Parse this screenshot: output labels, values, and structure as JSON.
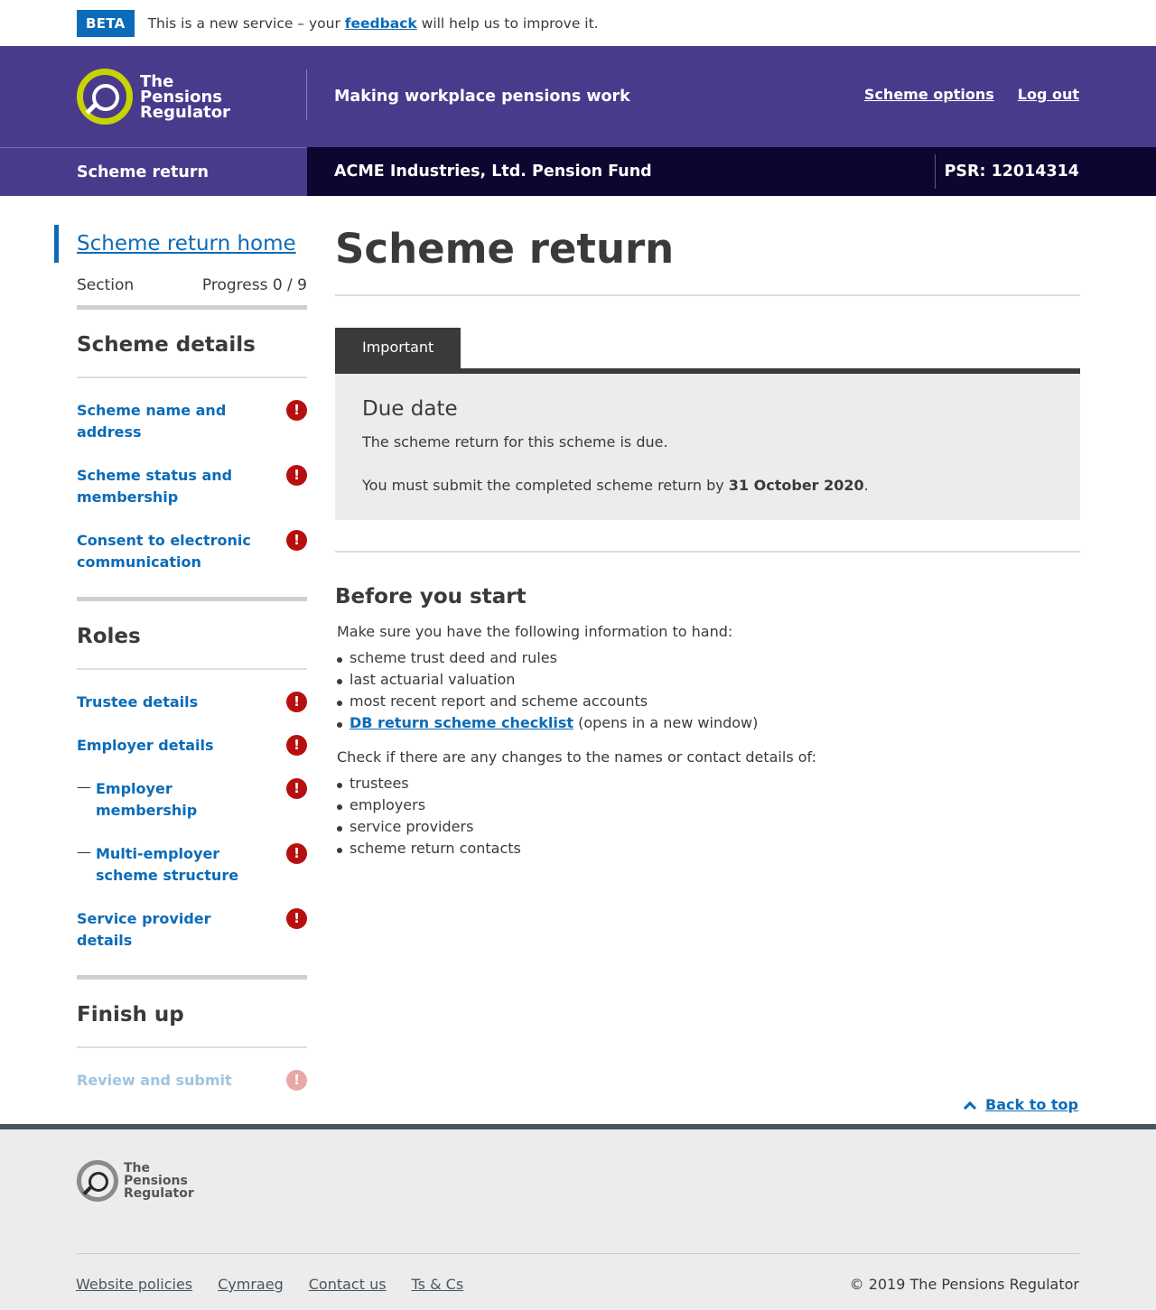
{
  "beta": {
    "tag": "BETA",
    "text_before": "This is a new service – your",
    "link": "feedback",
    "text_after": "will help us to improve it."
  },
  "header": {
    "logo_lines": [
      "The",
      "Pensions",
      "Regulator"
    ],
    "tagline": "Making workplace pensions work",
    "links": [
      "Scheme options",
      "Log out"
    ]
  },
  "subheader": {
    "section": "Scheme return",
    "scheme_name": "ACME Industries, Ltd. Pension Fund",
    "psr": "PSR: 12014314"
  },
  "sidebar": {
    "home_link": "Scheme return home",
    "section_label": "Section",
    "progress_label": "Progress 0 / 9",
    "groups": [
      {
        "heading": "Scheme details",
        "items": [
          {
            "label": "Scheme name and address",
            "indent": false
          },
          {
            "label": "Scheme status and membership",
            "indent": false
          },
          {
            "label": "Consent to electronic communication",
            "indent": false
          }
        ]
      },
      {
        "heading": "Roles",
        "items": [
          {
            "label": "Trustee details",
            "indent": false
          },
          {
            "label": "Employer details",
            "indent": false
          },
          {
            "label": "Employer membership",
            "indent": true
          },
          {
            "label": "Multi-employer scheme structure",
            "indent": true
          },
          {
            "label": "Service provider details",
            "indent": false
          }
        ]
      },
      {
        "heading": "Finish up",
        "items": [
          {
            "label": "Review and submit",
            "indent": false,
            "disabled": true
          }
        ]
      }
    ],
    "alert_glyph": "!",
    "dash_glyph": "—"
  },
  "main": {
    "title": "Scheme return",
    "important_tab": "Important",
    "due_heading": "Due date",
    "due_text": "The scheme return for this scheme is due.",
    "submit_text_before": "You must submit the completed scheme return by",
    "submit_date": "31 October 2020",
    "submit_text_after": ".",
    "before_heading": "Before you start",
    "before_intro": "Make sure you have the following information to hand:",
    "before_items": [
      "scheme trust deed and rules",
      "last actuarial valuation",
      "most recent report and scheme accounts"
    ],
    "checklist_link": "DB return scheme checklist",
    "checklist_suffix": "(opens in a new window)",
    "check_intro": "Check if there are any changes to the names or contact details of:",
    "check_items": [
      "trustees",
      "employers",
      "service providers",
      "scheme return contacts"
    ]
  },
  "back_to_top": "Back to top",
  "footer": {
    "logo_lines": [
      "The",
      "Pensions",
      "Regulator"
    ],
    "links": [
      "Website policies",
      "Cymraeg",
      "Contact us",
      "Ts & Cs"
    ],
    "copyright": "© 2019 The Pensions Regulator"
  },
  "colors": {
    "header_purple": "#4a3a8c",
    "subheader_dark": "#0c0630",
    "link_blue": "#0b6bb8",
    "logo_green": "#c8d400",
    "alert_red": "#b70f0f"
  }
}
